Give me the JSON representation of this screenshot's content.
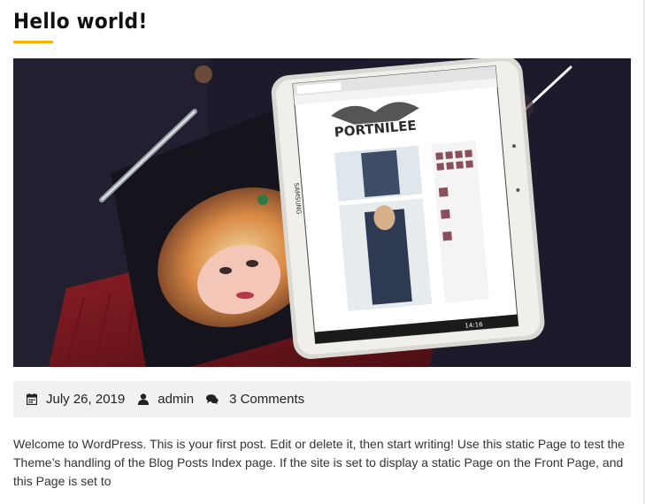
{
  "post": {
    "title": "Hello world!",
    "meta": {
      "date": "July 26, 2019",
      "author": "admin",
      "comments": "3 Comments"
    },
    "excerpt": "Welcome to WordPress. This is your first post. Edit or delete it, then start writing! Use this static Page to test the Theme’s handling of the Blog Posts Index page. If the site is set to display a static Page on the Front Page, and this Page is set to"
  },
  "featured_image": {
    "tablet_site_logo": "PORTNILEE",
    "tablet_brand": "SAMSUNG",
    "tablet_time": "14:16"
  },
  "icons": {
    "date": "calendar-icon",
    "author": "user-icon",
    "comments": "comments-icon"
  },
  "colors": {
    "accent": "#f5b400",
    "meta_bg": "#f1f1f1"
  }
}
